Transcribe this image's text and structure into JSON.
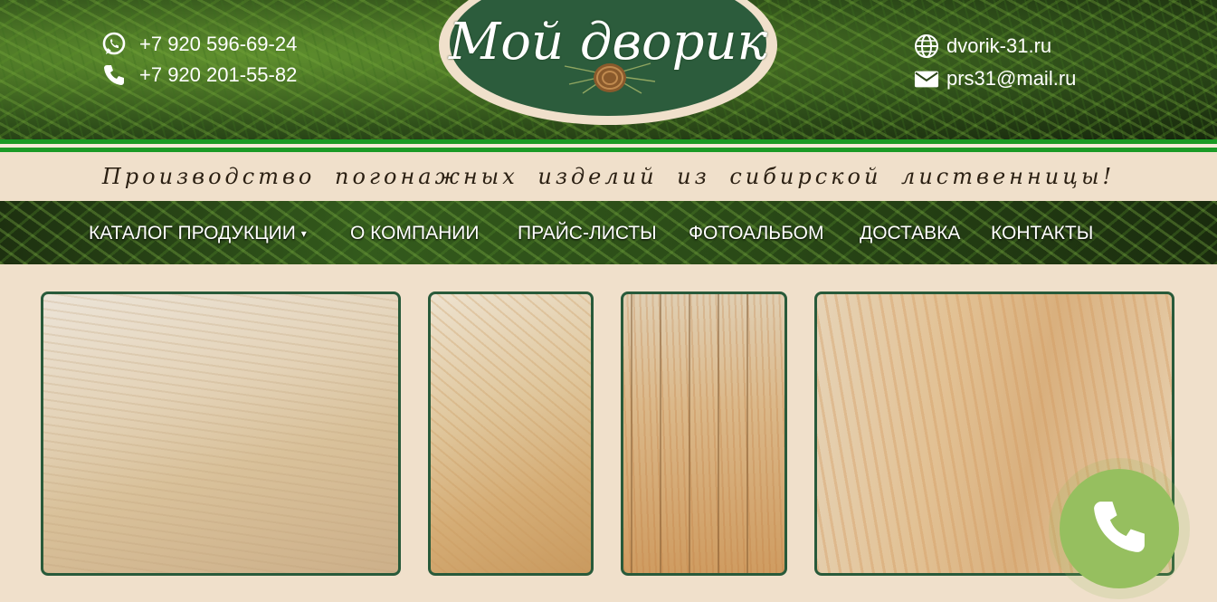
{
  "header": {
    "phones": [
      "+7 920 596-69-24",
      "+7 920 201-55-82"
    ],
    "website": "dvorik-31.ru",
    "email": "prs31@mail.ru",
    "logo_text": "Мой дворик",
    "slogan": "Производство погонажных изделий из сибирской лиственницы!"
  },
  "nav": {
    "items": [
      "КАТАЛОГ ПРОДУКЦИИ",
      "О КОМПАНИИ",
      "ПРАЙС-ЛИСТЫ",
      "ФОТОАЛЬБОМ",
      "ДОСТАВКА",
      "КОНТАКТЫ"
    ]
  },
  "colors": {
    "brand_green": "#1a9a25",
    "logo_green": "#2c5c3c",
    "cream": "#f0e0cb",
    "call_button": "#96bf5f"
  },
  "icons": [
    "whatsapp-icon",
    "phone-icon",
    "globe-icon",
    "email-icon",
    "call-icon"
  ]
}
